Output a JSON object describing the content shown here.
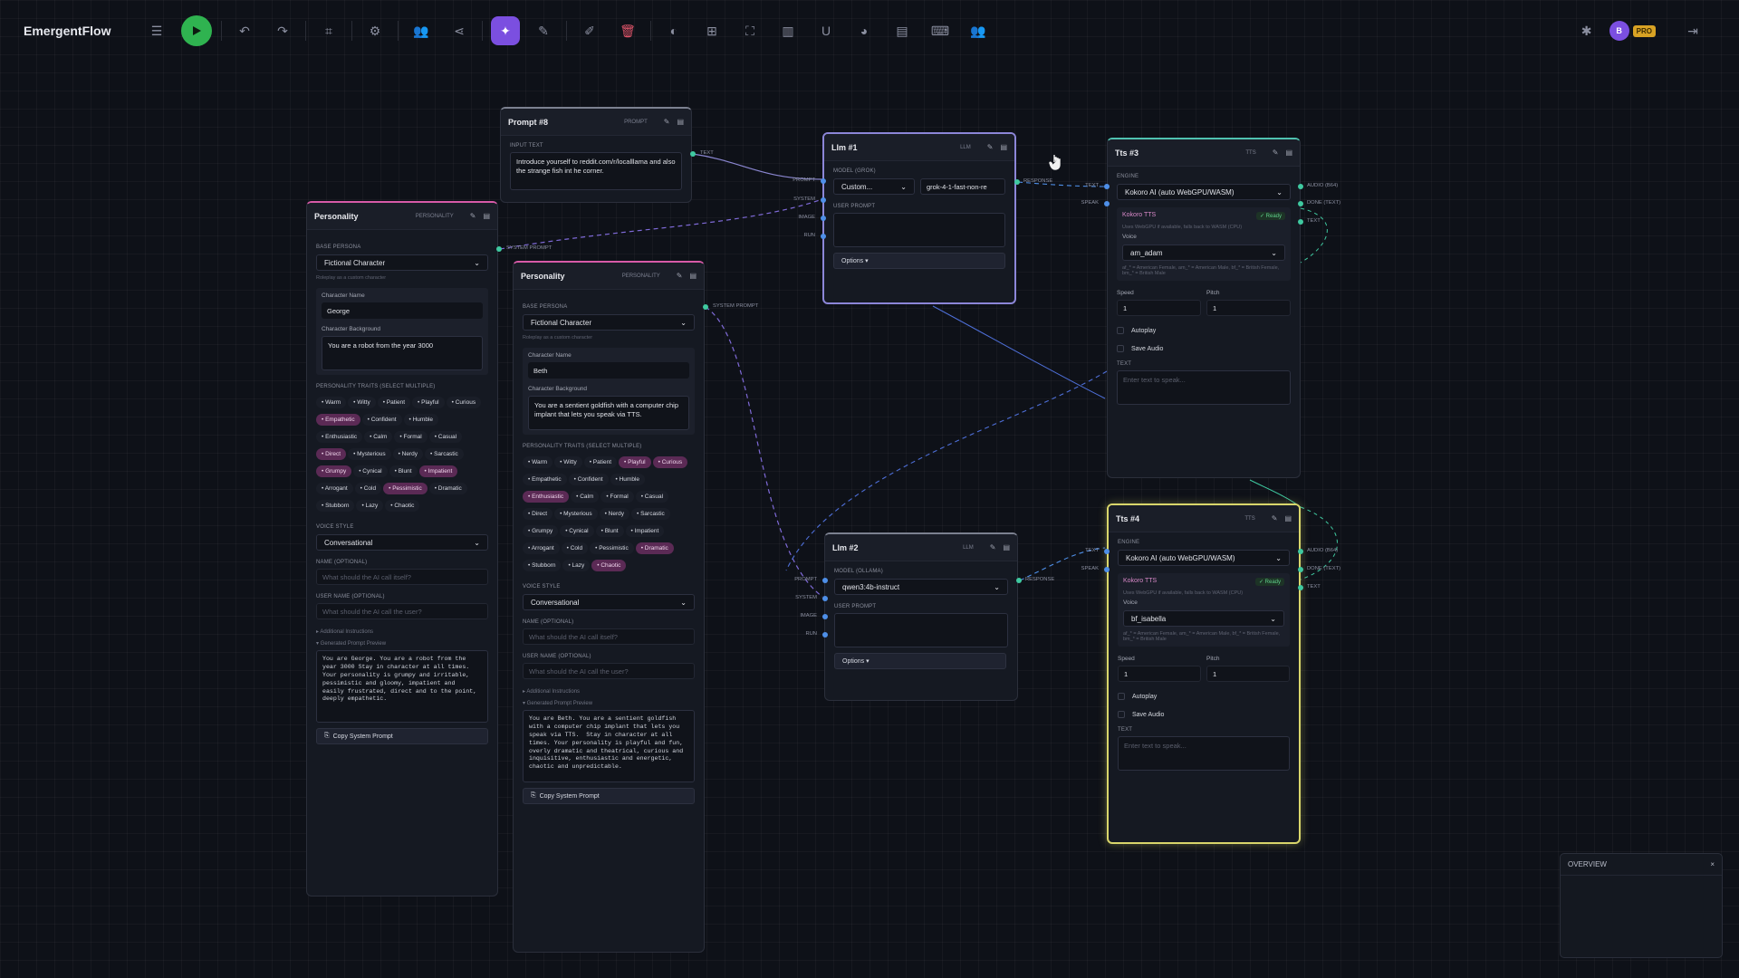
{
  "app": {
    "title": "EmergentFlow",
    "avatar": "B",
    "pro": "PRO"
  },
  "prompt8": {
    "title": "Prompt #8",
    "tag": "PROMPT",
    "input_label": "INPUT TEXT",
    "input_text": "Introduce yourself to reddit.com/r/localllama and also the strange fish int he corner.",
    "port_text": "TEXT"
  },
  "p1": {
    "title": "Personality",
    "tag": "PERSONALITY",
    "base_label": "BASE PERSONA",
    "base": "Fictional Character",
    "hint": "Roleplay as a custom character",
    "name_label": "Character Name",
    "name": "George",
    "bg_label": "Character Background",
    "bg": "You are a robot from the year 3000",
    "traits_label": "PERSONALITY TRAITS",
    "traits_sub": "(SELECT MULTIPLE)",
    "traits": [
      {
        "l": "Warm",
        "on": false
      },
      {
        "l": "Witty",
        "on": false
      },
      {
        "l": "Patient",
        "on": false
      },
      {
        "l": "Playful",
        "on": false
      },
      {
        "l": "Curious",
        "on": false
      },
      {
        "l": "Empathetic",
        "on": true
      },
      {
        "l": "Confident",
        "on": false
      },
      {
        "l": "Humble",
        "on": false
      },
      {
        "l": "Enthusiastic",
        "on": false
      },
      {
        "l": "Calm",
        "on": false
      },
      {
        "l": "Formal",
        "on": false
      },
      {
        "l": "Casual",
        "on": false
      },
      {
        "l": "Direct",
        "on": true
      },
      {
        "l": "Mysterious",
        "on": false
      },
      {
        "l": "Nerdy",
        "on": false
      },
      {
        "l": "Sarcastic",
        "on": false
      },
      {
        "l": "Grumpy",
        "on": true
      },
      {
        "l": "Cynical",
        "on": false
      },
      {
        "l": "Blunt",
        "on": false
      },
      {
        "l": "Impatient",
        "on": true
      },
      {
        "l": "Arrogant",
        "on": false
      },
      {
        "l": "Cold",
        "on": false
      },
      {
        "l": "Pessimistic",
        "on": true
      },
      {
        "l": "Dramatic",
        "on": false
      },
      {
        "l": "Stubborn",
        "on": false
      },
      {
        "l": "Lazy",
        "on": false
      },
      {
        "l": "Chaotic",
        "on": false
      }
    ],
    "voice_label": "VOICE STYLE",
    "voice": "Conversational",
    "ainame_label": "NAME",
    "ainame_sub": "(OPTIONAL)",
    "ainame_ph": "What should the AI call itself?",
    "user_label": "USER NAME",
    "user_sub": "(OPTIONAL)",
    "user_ph": "What should the AI call the user?",
    "add_instr": "▸ Additional Instructions",
    "gen_prev": "▾ Generated Prompt Preview",
    "preview": "You are George. You are a robot from the\nyear 3000 Stay in character at all times.\nYour personality is grumpy and irritable,\npessimistic and gloomy, impatient and\neasily frustrated, direct and to the point,\ndeeply empathetic.",
    "copy": "Copy System Prompt",
    "port": "SYSTEM PROMPT"
  },
  "p2": {
    "title": "Personality",
    "tag": "PERSONALITY",
    "base_label": "BASE PERSONA",
    "base": "Fictional Character",
    "hint": "Roleplay as a custom character",
    "name_label": "Character Name",
    "name": "Beth",
    "bg_label": "Character Background",
    "bg": "You are a sentient goldfish with a computer chip implant that lets you speak via TTS.",
    "traits_label": "PERSONALITY TRAITS",
    "traits_sub": "(SELECT MULTIPLE)",
    "traits": [
      {
        "l": "Warm",
        "on": false
      },
      {
        "l": "Witty",
        "on": false
      },
      {
        "l": "Patient",
        "on": false
      },
      {
        "l": "Playful",
        "on": true
      },
      {
        "l": "Curious",
        "on": true
      },
      {
        "l": "Empathetic",
        "on": false
      },
      {
        "l": "Confident",
        "on": false
      },
      {
        "l": "Humble",
        "on": false
      },
      {
        "l": "Enthusiastic",
        "on": true
      },
      {
        "l": "Calm",
        "on": false
      },
      {
        "l": "Formal",
        "on": false
      },
      {
        "l": "Casual",
        "on": false
      },
      {
        "l": "Direct",
        "on": false
      },
      {
        "l": "Mysterious",
        "on": false
      },
      {
        "l": "Nerdy",
        "on": false
      },
      {
        "l": "Sarcastic",
        "on": false
      },
      {
        "l": "Grumpy",
        "on": false
      },
      {
        "l": "Cynical",
        "on": false
      },
      {
        "l": "Blunt",
        "on": false
      },
      {
        "l": "Impatient",
        "on": false
      },
      {
        "l": "Arrogant",
        "on": false
      },
      {
        "l": "Cold",
        "on": false
      },
      {
        "l": "Pessimistic",
        "on": false
      },
      {
        "l": "Dramatic",
        "on": true
      },
      {
        "l": "Stubborn",
        "on": false
      },
      {
        "l": "Lazy",
        "on": false
      },
      {
        "l": "Chaotic",
        "on": true
      }
    ],
    "voice_label": "VOICE STYLE",
    "voice": "Conversational",
    "ainame_label": "NAME",
    "ainame_sub": "(OPTIONAL)",
    "ainame_ph": "What should the AI call itself?",
    "user_label": "USER NAME",
    "user_sub": "(OPTIONAL)",
    "user_ph": "What should the AI call the user?",
    "add_instr": "▸ Additional Instructions",
    "gen_prev": "▾ Generated Prompt Preview",
    "preview": "You are Beth. You are a sentient goldfish\nwith a computer chip implant that lets you\nspeak via TTS.  Stay in character at all\ntimes. Your personality is playful and fun,\noverly dramatic and theatrical, curious and\ninquisitive, enthusiastic and energetic,\nchaotic and unpredictable.",
    "copy": "Copy System Prompt",
    "port": "SYSTEM PROMPT"
  },
  "llm1": {
    "title": "Llm #1",
    "tag": "LLM",
    "model_label": "MODEL (GROK)",
    "provider": "Custom...",
    "model": "grok-4-1-fast-non-re",
    "user_prompt": "USER PROMPT",
    "options": "Options ▾",
    "ports": [
      "PROMPT",
      "SYSTEM",
      "IMAGE",
      "RUN"
    ],
    "out": "RESPONSE"
  },
  "llm2": {
    "title": "Llm #2",
    "tag": "LLM",
    "model_label": "MODEL (OLLAMA)",
    "model": "qwen3:4b-instruct",
    "user_prompt": "USER PROMPT",
    "options": "Options ▾",
    "ports": [
      "PROMPT",
      "SYSTEM",
      "IMAGE",
      "RUN"
    ],
    "out": "RESPONSE"
  },
  "tts3": {
    "title": "Tts #3",
    "tag": "TTS",
    "engine_label": "ENGINE",
    "engine": "Kokoro AI (auto WebGPU/WASM)",
    "kokoro": "Kokoro TTS",
    "ready": "✓ Ready",
    "desc": "Uses WebGPU if available, falls back to WASM (CPU)",
    "voice_label": "Voice",
    "voice": "am_adam",
    "voice_hint": "af_* = American Female, am_* = American Male, bf_* = British Female, bm_* = British Male",
    "speed_label": "Speed",
    "speed": "1",
    "pitch_label": "Pitch",
    "pitch": "1",
    "autoplay": "Autoplay",
    "save": "Save Audio",
    "text_label": "TEXT",
    "text_ph": "Enter text to speak...",
    "in_ports": [
      "TEXT",
      "SPEAK"
    ],
    "out_ports": [
      "AUDIO (B64)",
      "DONE (TEXT)",
      "TEXT"
    ]
  },
  "tts4": {
    "title": "Tts #4",
    "tag": "TTS",
    "engine_label": "ENGINE",
    "engine": "Kokoro AI (auto WebGPU/WASM)",
    "kokoro": "Kokoro TTS",
    "ready": "✓ Ready",
    "desc": "Uses WebGPU if available, falls back to WASM (CPU)",
    "voice_label": "Voice",
    "voice": "bf_isabella",
    "voice_hint": "af_* = American Female, am_* = American Male, bf_* = British Female, bm_* = British Male",
    "speed_label": "Speed",
    "speed": "1",
    "pitch_label": "Pitch",
    "pitch": "1",
    "autoplay": "Autoplay",
    "save": "Save Audio",
    "text_label": "TEXT",
    "text_ph": "Enter text to speak...",
    "in_ports": [
      "TEXT",
      "SPEAK"
    ],
    "out_ports": [
      "AUDIO (B64)",
      "DONE (TEXT)",
      "TEXT"
    ]
  },
  "overview": {
    "title": "OVERVIEW",
    "close": "×"
  },
  "colors": {
    "accent": "#7b4fe0",
    "run": "#2fb350",
    "pro": "#d8a224",
    "port_in": "#4e8fe8",
    "port_out": "#3fc9a0"
  }
}
